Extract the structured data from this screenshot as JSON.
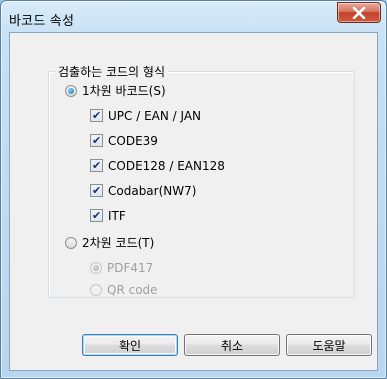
{
  "window": {
    "title": "바코드 속성",
    "close_symbol": "X"
  },
  "group": {
    "legend": "검출하는 코드의 형식"
  },
  "options": {
    "one_d": {
      "label": "1차원 바코드(S)",
      "checked": true
    },
    "two_d": {
      "label": "2차원 코드(T)",
      "checked": false
    }
  },
  "one_d_types": [
    {
      "label": "UPC / EAN / JAN",
      "checked": true
    },
    {
      "label": "CODE39",
      "checked": true
    },
    {
      "label": "CODE128 / EAN128",
      "checked": true
    },
    {
      "label": "Codabar(NW7)",
      "checked": true
    },
    {
      "label": "ITF",
      "checked": true
    }
  ],
  "two_d_types": [
    {
      "label": "PDF417",
      "checked": true,
      "enabled": false
    },
    {
      "label": "QR code",
      "checked": false,
      "enabled": false
    }
  ],
  "buttons": {
    "ok": "확인",
    "cancel": "취소",
    "help": "도움말"
  },
  "check_glyph": "✔"
}
